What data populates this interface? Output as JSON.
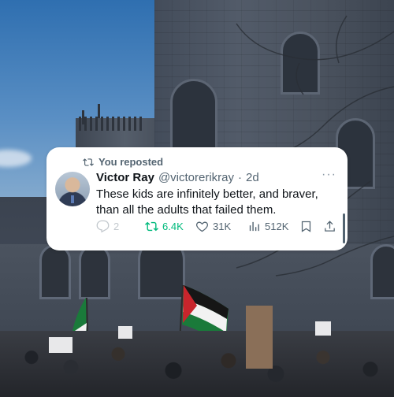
{
  "repost": {
    "label": "You reposted",
    "icon": "retweet-icon"
  },
  "tweet": {
    "author": {
      "display_name": "Victor Ray",
      "handle": "@victorerikray",
      "separator": "·",
      "time": "2d",
      "avatar": "avatar"
    },
    "text": "These kids are infinitely better, and braver, than all the adults that failed them.",
    "more_icon": "more-horizontal-icon",
    "more_label": "···",
    "actions": {
      "reply": {
        "icon": "reply-icon",
        "count": "2"
      },
      "retweet": {
        "icon": "retweet-icon",
        "count": "6.4K",
        "color": "#00ba7c"
      },
      "like": {
        "icon": "heart-icon",
        "count": "31K"
      },
      "views": {
        "icon": "views-icon",
        "count": "512K"
      },
      "bookmark": {
        "icon": "bookmark-icon"
      },
      "share": {
        "icon": "share-icon"
      }
    }
  },
  "colors": {
    "text_primary": "#0f1419",
    "text_secondary": "#536471",
    "retweet_green": "#00ba7c",
    "card_bg": "#ffffff"
  }
}
